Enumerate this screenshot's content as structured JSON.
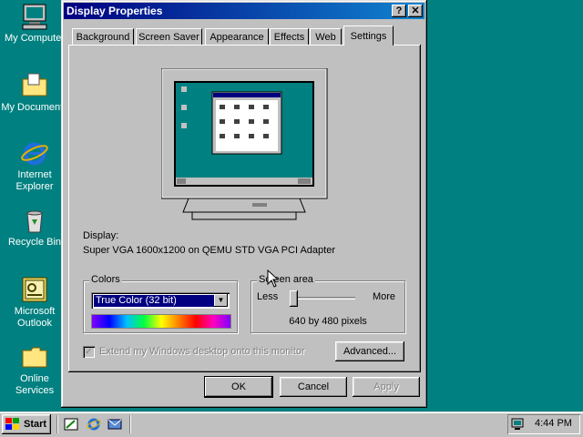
{
  "desktop": {
    "icons": [
      {
        "label": "My Computer",
        "icon": "computer-icon"
      },
      {
        "label": "My Documents",
        "icon": "folder-icon"
      },
      {
        "label": "Internet Explorer",
        "icon": "ie-icon"
      },
      {
        "label": "Recycle Bin",
        "icon": "recycle-bin-icon"
      },
      {
        "label": "Microsoft Outlook",
        "icon": "outlook-icon"
      },
      {
        "label": "Online Services",
        "icon": "folder-icon"
      }
    ]
  },
  "dialog": {
    "title": "Display Properties",
    "help_btn": "?",
    "close_btn": "✕",
    "tabs": [
      "Background",
      "Screen Saver",
      "Appearance",
      "Effects",
      "Web",
      "Settings"
    ],
    "active_tab": "Settings",
    "display_label": "Display:",
    "display_value": "Super VGA 1600x1200 on QEMU STD VGA PCI Adapter",
    "colors": {
      "label": "Colors",
      "selected": "True Color (32 bit)"
    },
    "screen_area": {
      "label": "Screen area",
      "less": "Less",
      "more": "More",
      "value_text": "640 by 480 pixels",
      "slider_position": 0
    },
    "extend_checkbox": {
      "label": "Extend my Windows desktop onto this monitor",
      "checked": true,
      "disabled": true
    },
    "advanced_btn": "Advanced...",
    "ok_btn": "OK",
    "cancel_btn": "Cancel",
    "apply_btn": "Apply"
  },
  "taskbar": {
    "start_label": "Start",
    "clock": "4:44 PM",
    "quick_launch": [
      "show-desktop-icon",
      "ie-icon",
      "outlook-express-icon"
    ]
  },
  "colors": {
    "desktop": "#008080",
    "title_start": "#000080",
    "title_end": "#1084d0",
    "face": "#c0c0c0",
    "select": "#000080"
  }
}
